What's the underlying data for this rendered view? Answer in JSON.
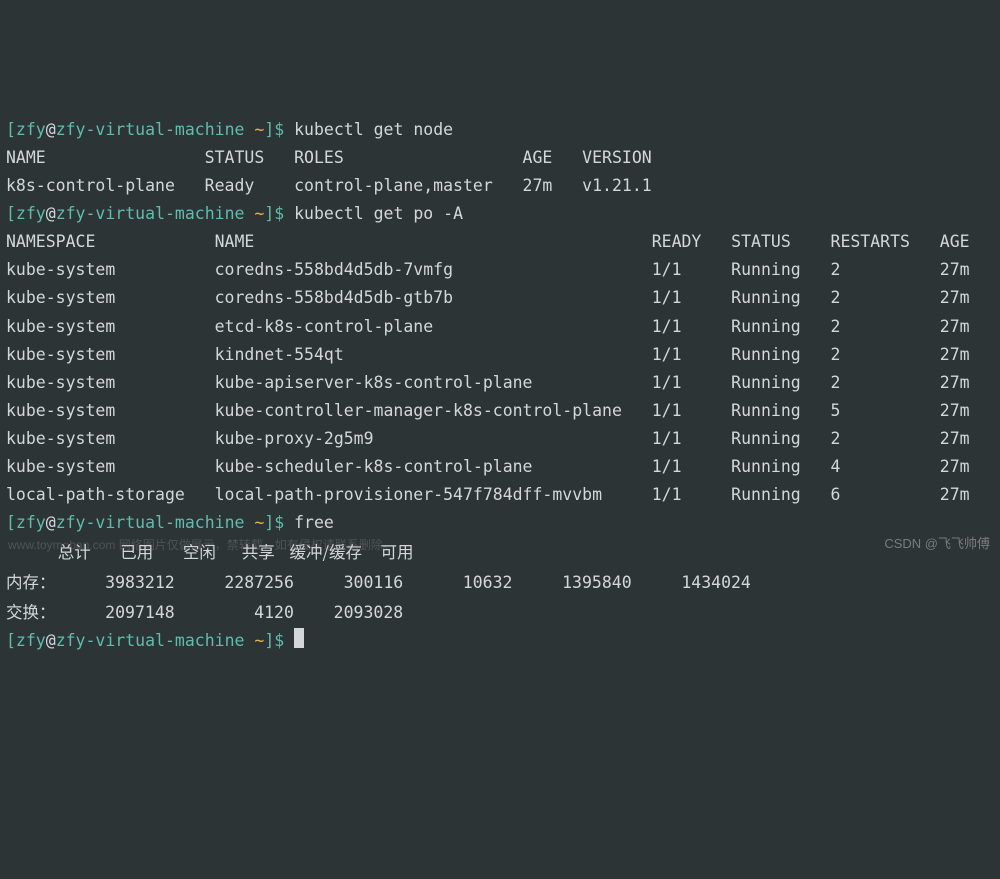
{
  "prompt": {
    "open": "[",
    "user": "zfy",
    "at": "@",
    "host": "zfy-virtual-machine",
    "path": " ~",
    "end": "]$ "
  },
  "cmd1": "kubectl get node",
  "nodes": {
    "header": {
      "name": "NAME",
      "status": "STATUS",
      "roles": "ROLES",
      "age": "AGE",
      "version": "VERSION"
    },
    "rows": [
      {
        "name": "k8s-control-plane",
        "status": "Ready",
        "roles": "control-plane,master",
        "age": "27m",
        "version": "v1.21.1"
      }
    ]
  },
  "cmd2": "kubectl get po -A",
  "pods": {
    "header": {
      "ns": "NAMESPACE",
      "name": "NAME",
      "ready": "READY",
      "status": "STATUS",
      "restarts": "RESTARTS",
      "age": "AGE"
    },
    "rows": [
      {
        "ns": "kube-system",
        "name": "coredns-558bd4d5db-7vmfg",
        "ready": "1/1",
        "status": "Running",
        "restarts": "2",
        "age": "27m"
      },
      {
        "ns": "kube-system",
        "name": "coredns-558bd4d5db-gtb7b",
        "ready": "1/1",
        "status": "Running",
        "restarts": "2",
        "age": "27m"
      },
      {
        "ns": "kube-system",
        "name": "etcd-k8s-control-plane",
        "ready": "1/1",
        "status": "Running",
        "restarts": "2",
        "age": "27m"
      },
      {
        "ns": "kube-system",
        "name": "kindnet-554qt",
        "ready": "1/1",
        "status": "Running",
        "restarts": "2",
        "age": "27m"
      },
      {
        "ns": "kube-system",
        "name": "kube-apiserver-k8s-control-plane",
        "ready": "1/1",
        "status": "Running",
        "restarts": "2",
        "age": "27m"
      },
      {
        "ns": "kube-system",
        "name": "kube-controller-manager-k8s-control-plane",
        "ready": "1/1",
        "status": "Running",
        "restarts": "5",
        "age": "27m"
      },
      {
        "ns": "kube-system",
        "name": "kube-proxy-2g5m9",
        "ready": "1/1",
        "status": "Running",
        "restarts": "2",
        "age": "27m"
      },
      {
        "ns": "kube-system",
        "name": "kube-scheduler-k8s-control-plane",
        "ready": "1/1",
        "status": "Running",
        "restarts": "4",
        "age": "27m"
      },
      {
        "ns": "local-path-storage",
        "name": "local-path-provisioner-547f784dff-mvvbm",
        "ready": "1/1",
        "status": "Running",
        "restarts": "6",
        "age": "27m"
      }
    ]
  },
  "cmd3": "free",
  "free": {
    "header": {
      "total": "总计",
      "used": "已用",
      "free": "空闲",
      "shared": "共享",
      "buff": "缓冲/缓存",
      "avail": "可用"
    },
    "mem": {
      "label": "内存：",
      "total": "3983212",
      "used": "2287256",
      "free": "300116",
      "shared": "10632",
      "buff": "1395840",
      "avail": "1434024"
    },
    "swap": {
      "label": "交换：",
      "total": "2097148",
      "used": "4120",
      "free": "2093028"
    }
  },
  "watermark1": "www.toymoban.com 网络图片仅做展示，禁转载，如有侵权请联系删除。",
  "watermark2": "CSDN @飞飞帅傅"
}
